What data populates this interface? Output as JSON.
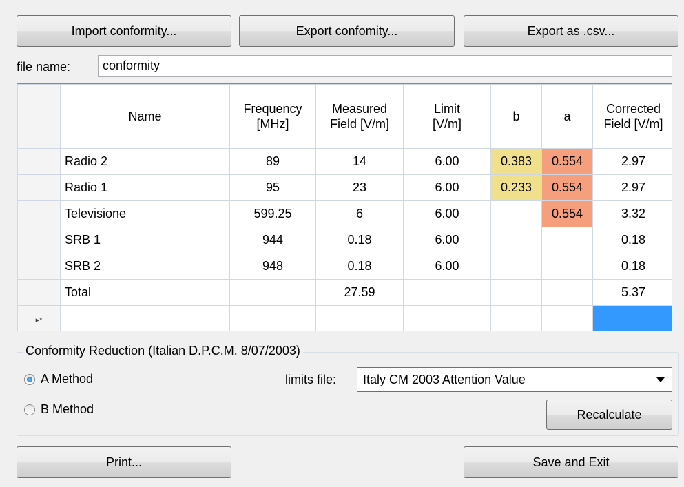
{
  "toolbar": {
    "import_label": "Import conformity...",
    "export_label": "Export confomity...",
    "csv_label": "Export as .csv..."
  },
  "file": {
    "label": "file name:",
    "value": "conformity"
  },
  "table": {
    "columns": [
      "Name",
      "Frequency [MHz]",
      "Measured Field [V/m]",
      "Limit [V/m]",
      "b",
      "a",
      "Corrected Field [V/m]"
    ],
    "column_lines": [
      [
        "Name"
      ],
      [
        "Frequency",
        "[MHz]"
      ],
      [
        "Measured",
        "Field [V/m]"
      ],
      [
        "Limit",
        "[V/m]"
      ],
      [
        "b"
      ],
      [
        "a"
      ],
      [
        "Corrected",
        "Field [V/m]"
      ]
    ],
    "rows": [
      [
        "Radio 2",
        "89",
        "14",
        "6.00",
        "0.383",
        "0.554",
        "2.97"
      ],
      [
        "Radio 1",
        "95",
        "23",
        "6.00",
        "0.233",
        "0.554",
        "2.97"
      ],
      [
        "Televisione",
        "599.25",
        "6",
        "6.00",
        "",
        "0.554",
        "3.32"
      ],
      [
        "SRB 1",
        "944",
        "0.18",
        "6.00",
        "",
        "",
        "0.18"
      ],
      [
        "SRB 2",
        "948",
        "0.18",
        "6.00",
        "",
        "",
        "0.18"
      ],
      [
        "Total",
        "",
        "27.59",
        "",
        "",
        "",
        "5.37"
      ]
    ],
    "new_row_marker": "▸*",
    "colors": {
      "b_highlight": "#f0e08c",
      "a_highlight": "#f59f7c",
      "selection": "#3399ff"
    }
  },
  "reduction": {
    "title": "Conformity Reduction (Italian D.P.C.M. 8/07/2003)",
    "method_a_label": "A Method",
    "method_b_label": "B Method",
    "selected_method": "A",
    "limits_label": "limits file:",
    "limits_value": "Italy CM 2003 Attention Value",
    "recalculate_label": "Recalculate"
  },
  "footer": {
    "print_label": "Print...",
    "save_exit_label": "Save and Exit"
  }
}
